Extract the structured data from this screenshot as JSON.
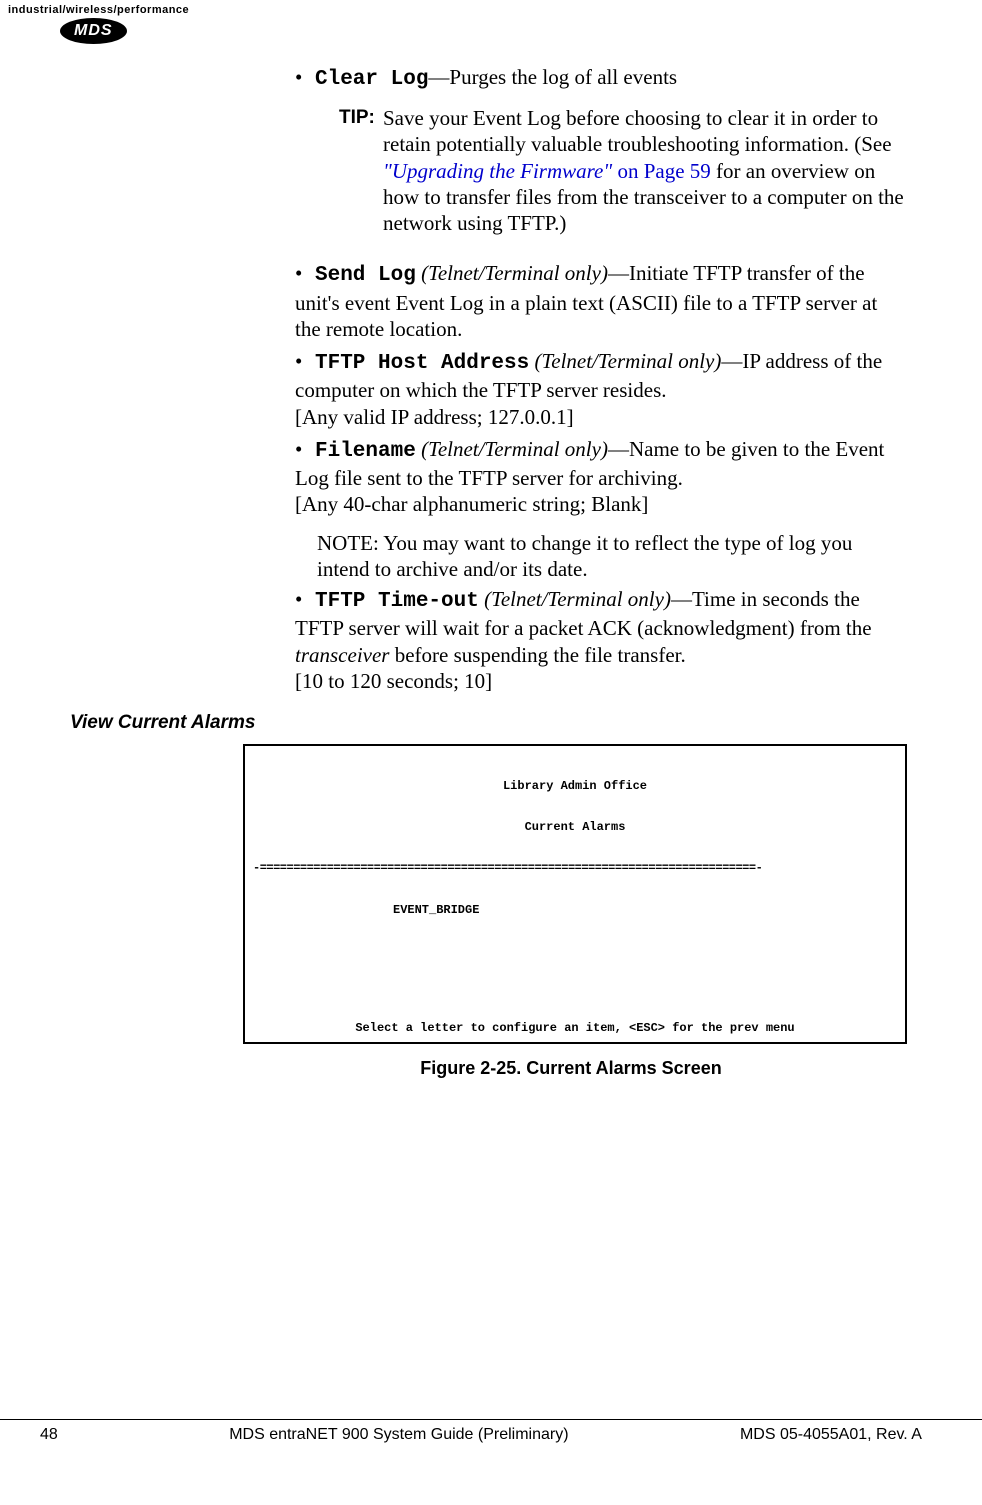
{
  "header": {
    "brand_tagline": "industrial/wireless/performance",
    "logo": "MDS"
  },
  "content": {
    "clear_log": {
      "label": "Clear Log",
      "desc": "—Purges the log of all events"
    },
    "tip": {
      "label": "TIP:",
      "text_before_link": "Save your Event Log before choosing to clear it in order to retain potentially valuable troubleshooting information. (See ",
      "link_italic": "\"Upgrading the Firmware\"",
      "link_rest": " on Page 59",
      "text_after_link": " for an overview on how to transfer files from the transceiver to a computer on the network using TFTP.)"
    },
    "send_log": {
      "label": "Send Log",
      "qualifier": " (Telnet/Terminal only)",
      "desc": "—Initiate TFTP transfer of the unit's event Event Log in a plain text (ASCII) file to a TFTP server at the remote location."
    },
    "tftp_host": {
      "label": "TFTP Host Address",
      "qualifier": "  (Telnet/Terminal only)",
      "desc": "—IP address of the computer on which the TFTP server resides.",
      "range": "[Any valid IP address; 127.0.0.1]"
    },
    "filename": {
      "label": "Filename",
      "qualifier": " (Telnet/Terminal only)",
      "desc": "—Name to be given to the Event Log file sent to the TFTP server for archiving.",
      "range": "[Any 40-char alphanumeric string; Blank]"
    },
    "note": "NOTE: You may want to change it to reflect the type of log you intend to archive and/or its date.",
    "tftp_timeout": {
      "label": "TFTP Time-out",
      "qualifier": "  (Telnet/Terminal only)",
      "desc_before": "—Time in seconds the TFTP server will wait for a packet ACK (acknowledgment) from the ",
      "desc_italic": "transceiver",
      "desc_after": " before suspending the file transfer.",
      "range": "[10 to 120 seconds; 10]"
    },
    "section_heading": "View Current Alarms",
    "terminal": {
      "title1": "Library Admin Office",
      "title2": "Current Alarms",
      "separator": "-==========================================================================-",
      "body": "EVENT_BRIDGE",
      "footer": "Select a letter to configure an item, <ESC> for the prev menu"
    },
    "figure_caption": "Figure 2-25. Current Alarms Screen"
  },
  "footer": {
    "page": "48",
    "center": "MDS entraNET 900 System Guide (Preliminary)",
    "right": "MDS 05-4055A01, Rev. A"
  }
}
